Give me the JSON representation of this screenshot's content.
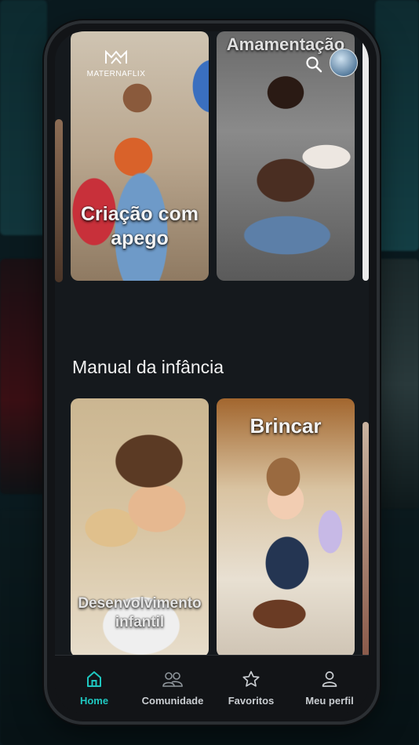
{
  "app": {
    "logo_text": "MATERNAFLIX"
  },
  "top_row": {
    "cards": [
      {
        "label_line1": "Criação com",
        "label_line2": "apego"
      },
      {
        "label": "Amamentação"
      }
    ]
  },
  "section": {
    "title": "Manual da infância",
    "cards": [
      {
        "label_line1": "Desenvolvimento",
        "label_line2": "infantil"
      },
      {
        "label": "Brincar"
      }
    ]
  },
  "bottom_nav": {
    "items": [
      {
        "label": "Home",
        "icon": "home-icon",
        "active": true
      },
      {
        "label": "Comunidade",
        "icon": "community-icon"
      },
      {
        "label": "Favoritos",
        "icon": "star-icon"
      },
      {
        "label": "Meu perfil",
        "icon": "user-icon"
      }
    ]
  },
  "colors": {
    "accent": "#1fc7c0",
    "background": "#15191d"
  }
}
